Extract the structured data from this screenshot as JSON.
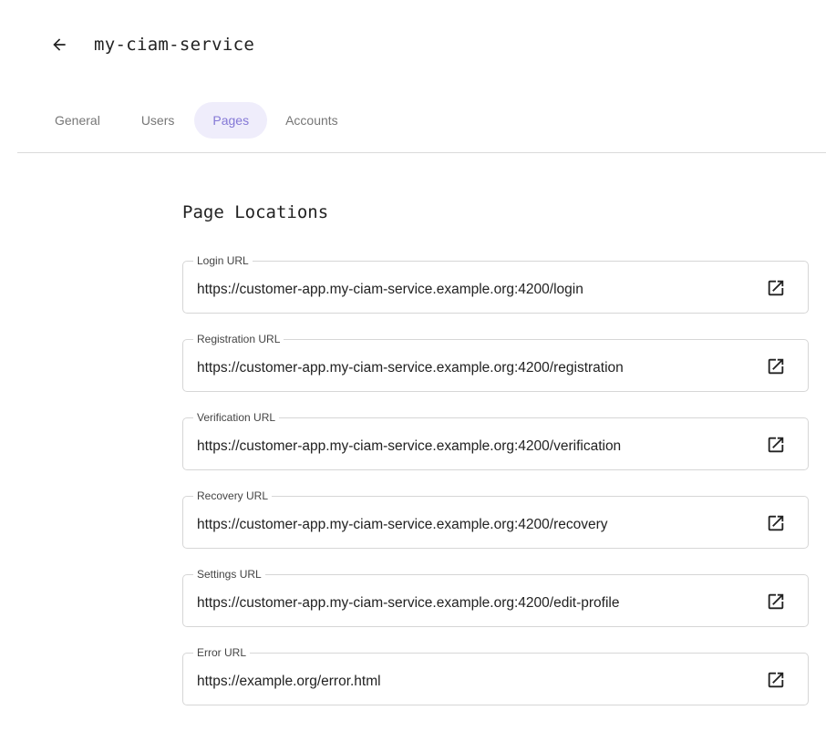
{
  "header": {
    "title": "my-ciam-service",
    "back_icon": "arrow-left-icon"
  },
  "tabs": [
    {
      "label": "General",
      "active": false
    },
    {
      "label": "Users",
      "active": false
    },
    {
      "label": "Pages",
      "active": true
    },
    {
      "label": "Accounts",
      "active": false
    }
  ],
  "page_locations": {
    "title": "Page Locations",
    "open_icon": "open-in-new-icon",
    "fields": [
      {
        "label": "Login URL",
        "value": "https://customer-app.my-ciam-service.example.org:4200/login"
      },
      {
        "label": "Registration URL",
        "value": "https://customer-app.my-ciam-service.example.org:4200/registration"
      },
      {
        "label": "Verification URL",
        "value": "https://customer-app.my-ciam-service.example.org:4200/verification"
      },
      {
        "label": "Recovery URL",
        "value": "https://customer-app.my-ciam-service.example.org:4200/recovery"
      },
      {
        "label": "Settings URL",
        "value": "https://customer-app.my-ciam-service.example.org:4200/edit-profile"
      },
      {
        "label": "Error URL",
        "value": "https://example.org/error.html"
      }
    ]
  },
  "colors": {
    "accent": "#8478d6",
    "accent_bg": "#efedfb",
    "border": "#d6d6d6"
  }
}
